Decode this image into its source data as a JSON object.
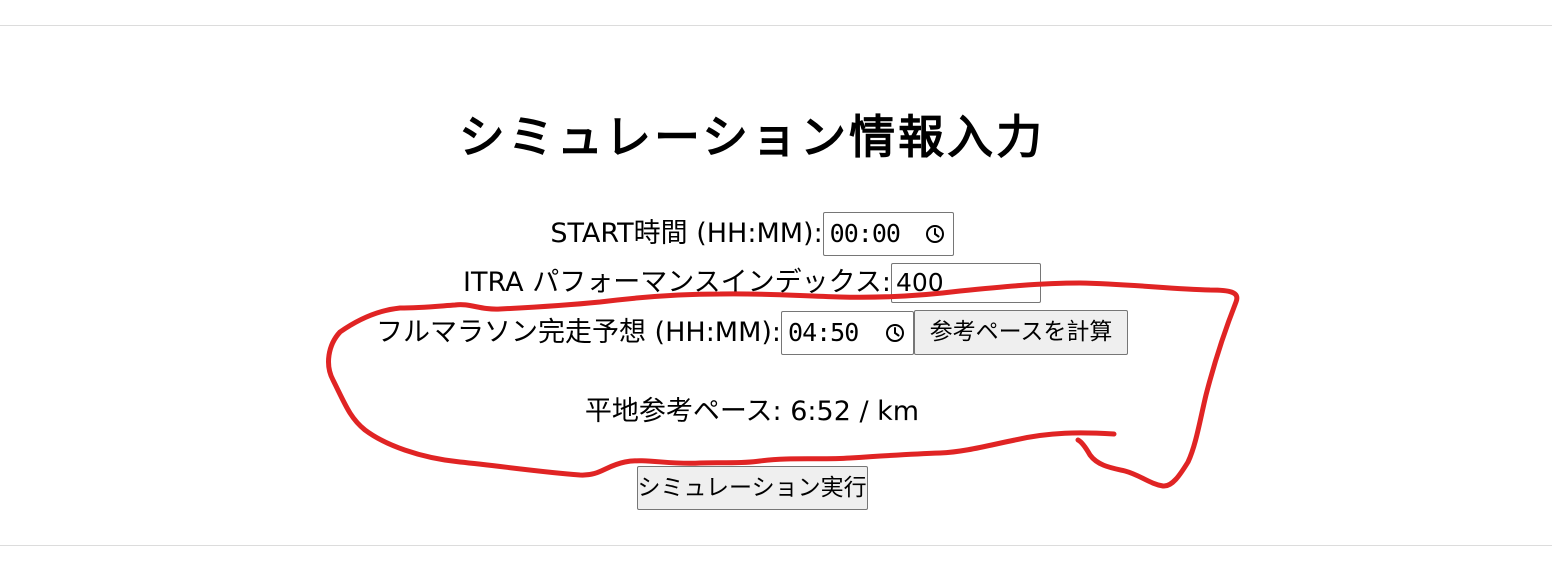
{
  "page": {
    "title": "シミュレーション情報入力"
  },
  "form": {
    "start_time": {
      "label": "START時間 (HH:MM):",
      "value": "00:00",
      "icon": "clock-icon"
    },
    "itra_index": {
      "label": "ITRA パフォーマンスインデックス:",
      "value": "400"
    },
    "marathon_time": {
      "label": "フルマラソン完走予想 (HH:MM):",
      "value": "04:50",
      "icon": "clock-icon"
    },
    "calc_button_label": "参考ペースを計算",
    "reference_pace": "平地参考ペース: 6:52 / km",
    "run_button_label": "シミュレーション実行"
  },
  "annotation": {
    "color": "#e02424"
  }
}
